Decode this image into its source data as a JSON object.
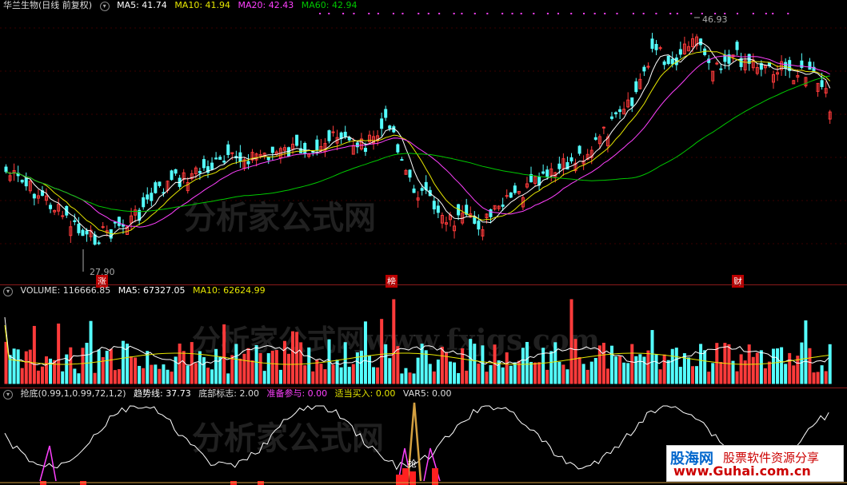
{
  "stock": {
    "title": "华兰生物(日线 前复权)",
    "ma5": "MA5: 41.74",
    "ma10": "MA10: 41.94",
    "ma20": "MA20: 42.43",
    "ma60": "MA60: 42.94",
    "high_label": "46.93",
    "low_label": "27.90",
    "markers": [
      "涨",
      "榜",
      "财"
    ]
  },
  "volume": {
    "label": "VOLUME: 116666.85",
    "ma5": "MA5: 67327.05",
    "ma10": "MA10: 62624.99"
  },
  "indicator": {
    "name": "抢底(0.99,1,0.99,72,1,2)",
    "trend": "趋势线: 37.73",
    "bottom": "底部标志: 2.00",
    "prepare": "准备参与: 0.00",
    "buy": "适当买入: 0.00",
    "var5": "VAR5: 0.00",
    "tag": "抢"
  },
  "watermarks": {
    "main": "分析家公式网",
    "volume": "分析家公式网www.fxjgs.com",
    "indicator": "分析家公式网"
  },
  "logo": {
    "brand": "股海网",
    "slogan": "股票软件资源分享",
    "url": "www.Guhai.com.cn"
  },
  "colors": {
    "up": "#ff3b3b",
    "down": "#54ffff",
    "ma5": "#ffffff",
    "ma10": "#e6e600",
    "ma20": "#ff40ff",
    "ma60": "#00c800"
  },
  "chart_data": {
    "type": "candlestick",
    "price_range": [
      27.9,
      46.93
    ],
    "series": [
      {
        "name": "MA5",
        "value": 41.74
      },
      {
        "name": "MA10",
        "value": 41.94
      },
      {
        "name": "MA20",
        "value": 42.43
      },
      {
        "name": "MA60",
        "value": 42.94
      }
    ],
    "volume": {
      "last": 116666.85,
      "ma5": 67327.05,
      "ma10": 62624.99
    }
  }
}
